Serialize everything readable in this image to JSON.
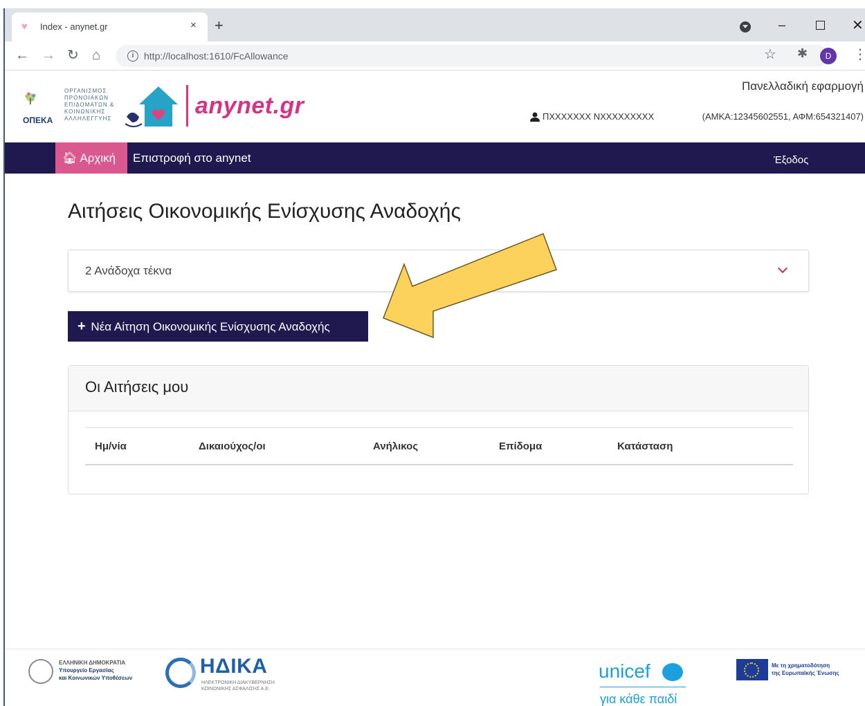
{
  "browser": {
    "tab_title": "Index - anynet.gr",
    "tab_close": "×",
    "new_tab": "+",
    "url": "http://localhost:1610/FcAllowance",
    "profile_initial": "D",
    "window_minimize": "–",
    "window_close": "✕",
    "back": "←",
    "forward": "→",
    "reload": "↻",
    "home": "⌂",
    "bookmark": "☆",
    "menu": "⋮"
  },
  "header": {
    "org_lines": [
      "ΟΡΓΑΝΙΣΜΟΣ",
      "ΠΡΟΝΟΙΑΚΩΝ",
      "ΕΠΙΔΟΜΑΤΩΝ &",
      "ΚΟΙΝΩΝΙΚΗΣ",
      "ΑΛΛΗΛΕΓΓΥΗΣ"
    ],
    "org_short": "ΟΠΕΚΑ",
    "brand": "anynet.gr",
    "nationwide": "Πανελλαδική εφαρμογή",
    "user_name": "ΠXXXXXXX NXXXXXXXXX",
    "user_ids": "(ΑΜΚΑ:12345602551, ΑΦΜ:654321407)"
  },
  "nav": {
    "home": "Αρχική",
    "back_to_anynet": "Επιστροφή στο anynet",
    "logout": "Έξοδος"
  },
  "main": {
    "page_title": "Αιτήσεις Οικονομικής Ενίσχυσης Αναδοχής",
    "foster_select_value": "2 Ανάδοχα τέκνα",
    "new_application_button": "Νέα Αίτηση Οικονομικής Ενίσχυσης Αναδοχής",
    "my_applications_title": "Οι Αιτήσεις μου",
    "table_headers": [
      "Ημ/νία",
      "Δικαιούχος/οι",
      "Ανήλικος",
      "Επίδομα",
      "Κατάσταση"
    ],
    "table_rows": []
  },
  "footer": {
    "gov_lines": [
      "ΕΛΛΗΝΙΚΗ ΔΗΜΟΚΡΑΤΙΑ",
      "Υπουργείο Εργασίας",
      "και Κοινωνικών Υποθέσεων"
    ],
    "idika": "ΗΔΙΚΑ",
    "idika_sub_lines": [
      "ΗΛΕΚΤΡΟΝΙΚΗ ΔΙΑΚΥΒΕΡΝΗΣΗ",
      "ΚΟΙΝΩΝΙΚΗΣ ΑΣΦΑΛΙΣΗΣ Α.Ε."
    ],
    "unicef": "unicef",
    "unicef_tagline": "για κάθε παιδί",
    "eu_lines": [
      "Με τη χρηματοδότηση",
      "της Ευρωπαϊκής Ένωσης"
    ]
  },
  "colors": {
    "navbar": "#20194f",
    "accent_pink": "#d9598f",
    "brand_pink": "#d63384",
    "arrow_fill": "#fcd25c"
  }
}
